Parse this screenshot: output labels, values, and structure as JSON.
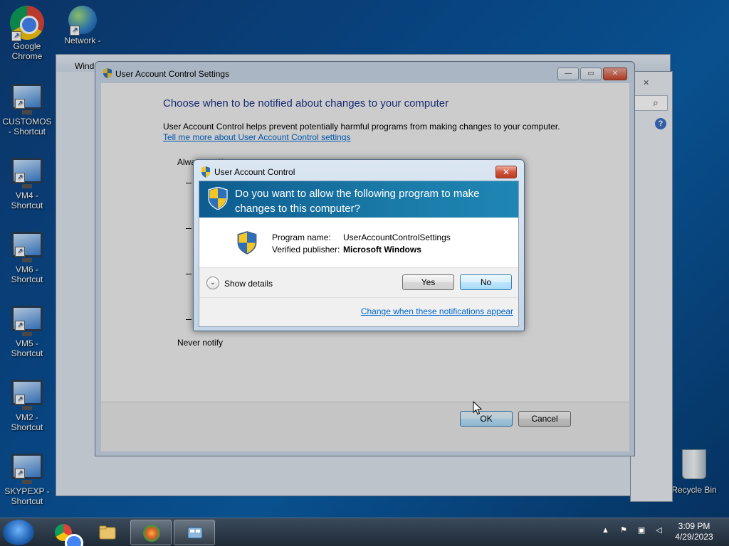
{
  "desktop": {
    "icons": [
      {
        "label": "Google Chrome"
      },
      {
        "label": "Network -"
      },
      {
        "label": "CUSTOMOS - Shortcut"
      },
      {
        "label": "VM4 - Shortcut"
      },
      {
        "label": "VM6 - Shortcut"
      },
      {
        "label": "VM5 - Shortcut"
      },
      {
        "label": "VM2 - Shortcut"
      },
      {
        "label": "SKYPEXP - Shortcut"
      },
      {
        "label": "Recycle Bin"
      }
    ]
  },
  "back_window": {
    "title": "Wind"
  },
  "settings_window": {
    "title": "User Account Control Settings",
    "heading": "Choose when to be notified about changes to your computer",
    "description": "User Account Control helps prevent potentially harmful programs from making changes to your computer.",
    "link": "Tell me more about User Account Control settings",
    "slider_top_label": "Always notify",
    "slider_bottom_label": "Never notify",
    "ok_label": "OK",
    "cancel_label": "Cancel"
  },
  "uac_dialog": {
    "title": "User Account Control",
    "question": "Do you want to allow the following program to make changes to this computer?",
    "program_name_label": "Program name:",
    "program_name_value": "UserAccountControlSettings",
    "publisher_label": "Verified publisher:",
    "publisher_value": "Microsoft Windows",
    "show_details": "Show details",
    "yes_label": "Yes",
    "no_label": "No",
    "change_link": "Change when these notifications appear"
  },
  "taskbar": {
    "clock_time": "3:09 PM",
    "clock_date": "4/29/2023"
  },
  "colors": {
    "uac_banner": "#1a7aa8",
    "link": "#0066cc",
    "heading": "#1e3287"
  }
}
